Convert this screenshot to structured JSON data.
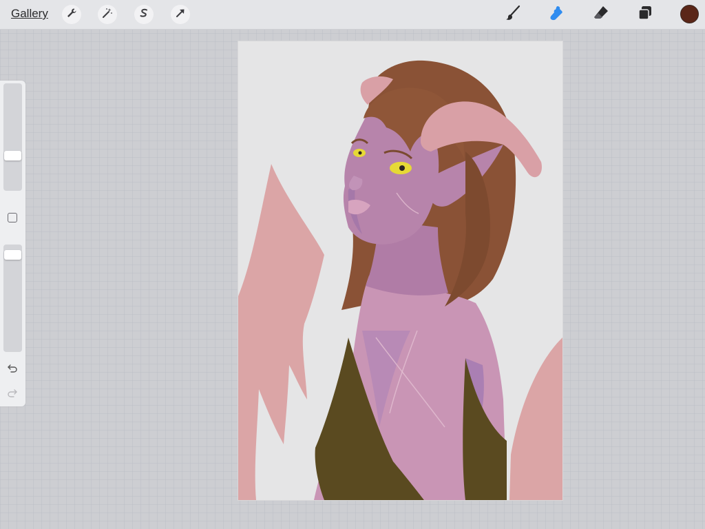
{
  "topbar": {
    "gallery_label": "Gallery",
    "left_tools": [
      {
        "name": "actions",
        "icon": "wrench-icon"
      },
      {
        "name": "adjustments",
        "icon": "magic-wand-icon"
      },
      {
        "name": "selection",
        "icon": "selection-s-icon"
      },
      {
        "name": "transform",
        "icon": "arrow-cursor-icon"
      }
    ],
    "right_tools": [
      {
        "name": "brush",
        "icon": "brush-icon",
        "active": false
      },
      {
        "name": "smudge",
        "icon": "smudge-icon",
        "active": true
      },
      {
        "name": "eraser",
        "icon": "eraser-icon",
        "active": false
      },
      {
        "name": "layers",
        "icon": "layers-icon",
        "active": false
      }
    ],
    "current_color": "#5a2618",
    "active_tool_color": "#2f8cf0"
  },
  "sidebar": {
    "brush_size_icon": "brush-size-slider",
    "modify_icon": "square-icon",
    "opacity_icon": "opacity-slider",
    "undo_icon": "undo-icon",
    "redo_icon": "redo-icon"
  },
  "artwork": {
    "subject": "illustration",
    "palette": {
      "background": "#e5e5e6",
      "wing": "#dba5a6",
      "hair": "#8a5236",
      "skin": "#b77fa3",
      "horn": "#d9a0a6",
      "dress": "#5a4a20",
      "eye": "#e6d936"
    }
  }
}
